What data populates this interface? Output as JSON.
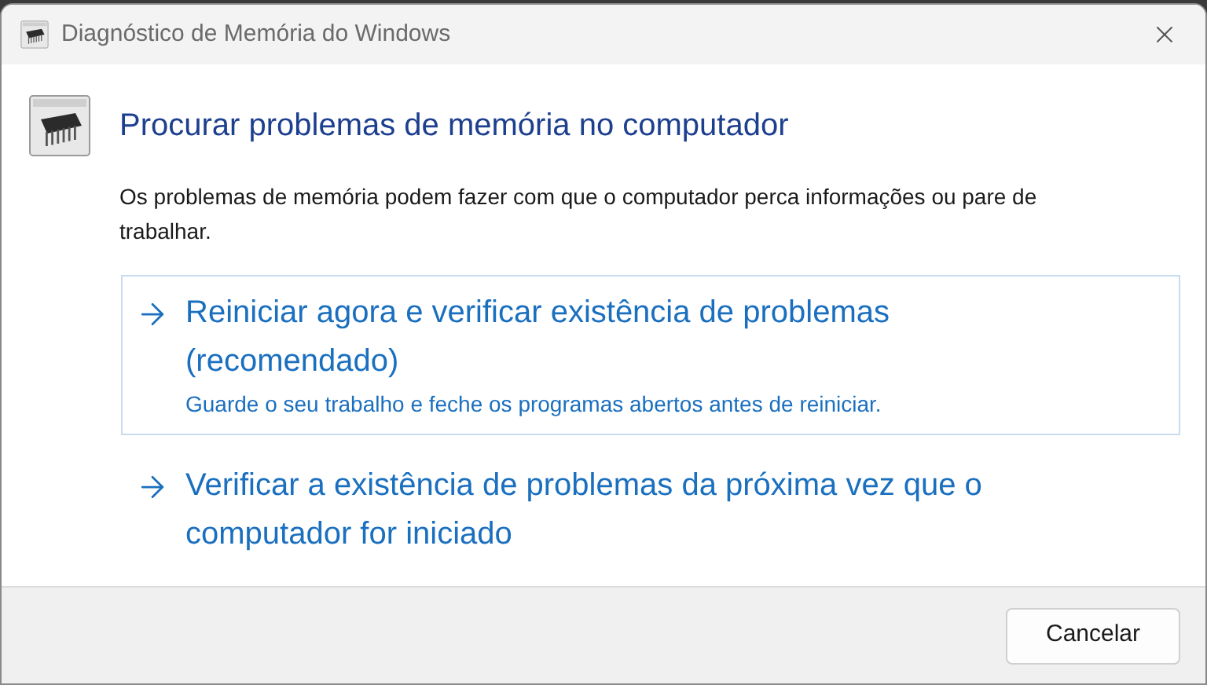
{
  "window": {
    "title": "Diagnóstico de Memória do Windows"
  },
  "heading": "Procurar problemas de memória no computador",
  "description": "Os problemas de memória podem fazer com que o computador perca informações ou pare de trabalhar.",
  "options": [
    {
      "label": "Reiniciar agora e verificar existência de problemas (recomendado)",
      "note": "Guarde o seu trabalho e feche os programas abertos antes de reiniciar.",
      "selected": true
    },
    {
      "label": "Verificar a existência de problemas da próxima vez que o computador for iniciado",
      "selected": false
    }
  ],
  "buttons": [
    "Cancelar"
  ]
}
